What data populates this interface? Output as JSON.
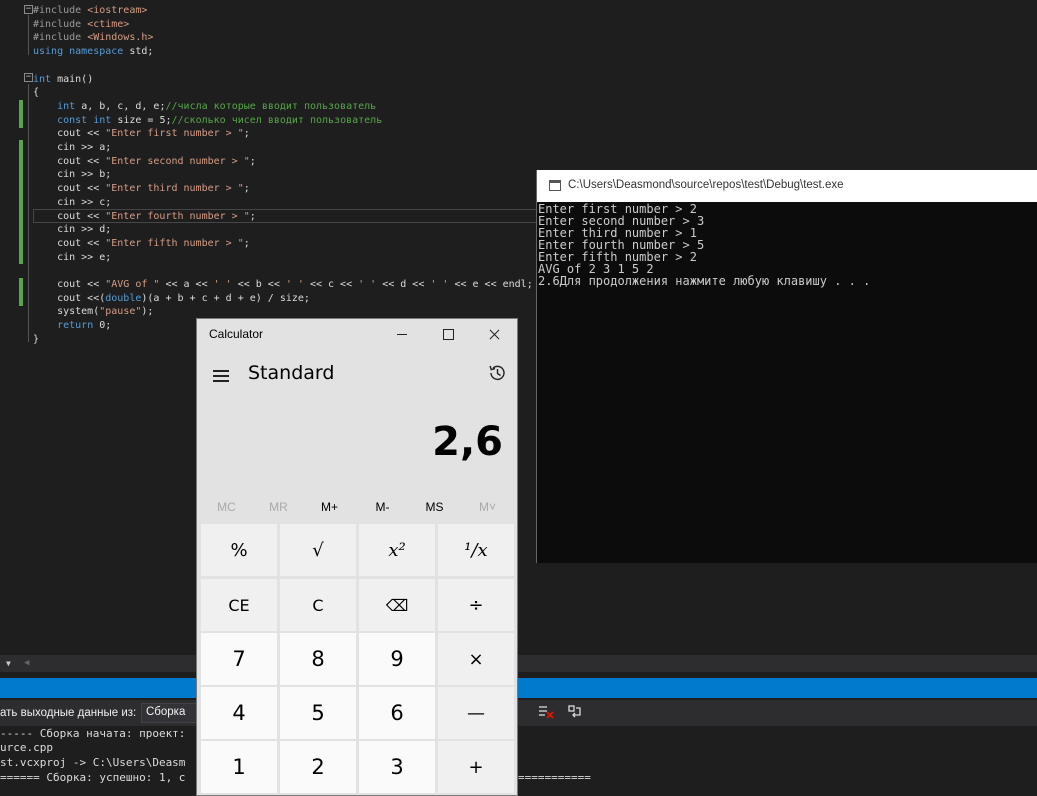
{
  "editor": {
    "lines": [
      [
        {
          "t": "#include ",
          "c": "pp"
        },
        {
          "t": "<iostream>",
          "c": "str"
        }
      ],
      [
        {
          "t": "#include ",
          "c": "pp"
        },
        {
          "t": "<ctime>",
          "c": "str"
        }
      ],
      [
        {
          "t": "#include ",
          "c": "pp"
        },
        {
          "t": "<Windows.h>",
          "c": "str"
        }
      ],
      [
        {
          "t": "using namespace ",
          "c": "kw"
        },
        {
          "t": "std;",
          "c": ""
        }
      ],
      [],
      [
        {
          "t": "int ",
          "c": "kw"
        },
        {
          "t": "main()",
          "c": ""
        }
      ],
      [
        {
          "t": "{",
          "c": ""
        }
      ],
      [
        {
          "t": "    ",
          "c": ""
        },
        {
          "t": "int ",
          "c": "kw"
        },
        {
          "t": "a, b, c, d, e;",
          "c": ""
        },
        {
          "t": "//числа которые вводит пользователь",
          "c": "cm"
        }
      ],
      [
        {
          "t": "    ",
          "c": ""
        },
        {
          "t": "const int ",
          "c": "kw"
        },
        {
          "t": "size = 5;",
          "c": ""
        },
        {
          "t": "//сколько чисел вводит пользователь",
          "c": "cm"
        }
      ],
      [
        {
          "t": "    cout << ",
          "c": ""
        },
        {
          "t": "\"Enter first number > \"",
          "c": "str"
        },
        {
          "t": ";",
          "c": ""
        }
      ],
      [
        {
          "t": "    cin >> a;",
          "c": ""
        }
      ],
      [
        {
          "t": "    cout << ",
          "c": ""
        },
        {
          "t": "\"Enter second number > \"",
          "c": "str"
        },
        {
          "t": ";",
          "c": ""
        }
      ],
      [
        {
          "t": "    cin >> b;",
          "c": ""
        }
      ],
      [
        {
          "t": "    cout << ",
          "c": ""
        },
        {
          "t": "\"Enter third number > \"",
          "c": "str"
        },
        {
          "t": ";",
          "c": ""
        }
      ],
      [
        {
          "t": "    cin >> c;",
          "c": ""
        }
      ],
      [
        {
          "t": "    cout << ",
          "c": ""
        },
        {
          "t": "\"Enter fourth number > \"",
          "c": "str"
        },
        {
          "t": ";",
          "c": ""
        }
      ],
      [
        {
          "t": "    cin >> d;",
          "c": ""
        }
      ],
      [
        {
          "t": "    cout << ",
          "c": ""
        },
        {
          "t": "\"Enter fifth number > \"",
          "c": "str"
        },
        {
          "t": ";",
          "c": ""
        }
      ],
      [
        {
          "t": "    cin >> e;",
          "c": ""
        }
      ],
      [],
      [
        {
          "t": "    cout << ",
          "c": ""
        },
        {
          "t": "\"AVG of \"",
          "c": "str"
        },
        {
          "t": " << a << ",
          "c": ""
        },
        {
          "t": "' '",
          "c": "str"
        },
        {
          "t": " << b << ",
          "c": ""
        },
        {
          "t": "' '",
          "c": "str"
        },
        {
          "t": " << c << ",
          "c": ""
        },
        {
          "t": "' '",
          "c": "str"
        },
        {
          "t": " << d << ",
          "c": ""
        },
        {
          "t": "' '",
          "c": "str"
        },
        {
          "t": " << e << endl;",
          "c": ""
        }
      ],
      [
        {
          "t": "    cout <<(",
          "c": ""
        },
        {
          "t": "double",
          "c": "kw"
        },
        {
          "t": ")(a + b + c + d + e) / size;",
          "c": ""
        }
      ],
      [
        {
          "t": "    system(",
          "c": ""
        },
        {
          "t": "\"pause\"",
          "c": "str"
        },
        {
          "t": ");",
          "c": ""
        }
      ],
      [
        {
          "t": "    ",
          "c": ""
        },
        {
          "t": "return ",
          "c": "kw"
        },
        {
          "t": "0;",
          "c": ""
        }
      ],
      [
        {
          "t": "}",
          "c": ""
        }
      ]
    ]
  },
  "output_panel": {
    "show_output_label": "ать выходные данные из:",
    "source_select": "Сборка",
    "lines": [
      "----- Сборка начата: проект: ",
      "urce.cpp",
      "st.vcxproj -> C:\\Users\\Deasm",
      "====== Сборка: успешно: 1, с"
    ],
    "tail_text": "==========="
  },
  "console": {
    "title": "C:\\Users\\Deasmond\\source\\repos\\test\\Debug\\test.exe",
    "lines": [
      "Enter first number > 2",
      "Enter second number > 3",
      "Enter third number > 1",
      "Enter fourth number > 5",
      "Enter fifth number > 2",
      "AVG of 2 3 1 5 2",
      "2.6Для продолжения нажмите любую клавишу . . ."
    ]
  },
  "calculator": {
    "app_title": "Calculator",
    "mode": "Standard",
    "display": "2,6",
    "memory": [
      {
        "label": "MC",
        "enabled": false
      },
      {
        "label": "MR",
        "enabled": false
      },
      {
        "label": "M+",
        "enabled": true
      },
      {
        "label": "M-",
        "enabled": true
      },
      {
        "label": "MS",
        "enabled": true
      },
      {
        "label": "M˅",
        "enabled": false
      }
    ],
    "keys": {
      "percent": "%",
      "sqrt": "√",
      "square": "x²",
      "reciprocal": "¹/x",
      "ce": "CE",
      "clear": "C",
      "backspace": "⌫",
      "divide": "÷",
      "seven": "7",
      "eight": "8",
      "nine": "9",
      "multiply": "×",
      "four": "4",
      "five": "5",
      "six": "6",
      "minus": "—",
      "one": "1",
      "two": "2",
      "three": "3",
      "plus": "+"
    }
  }
}
